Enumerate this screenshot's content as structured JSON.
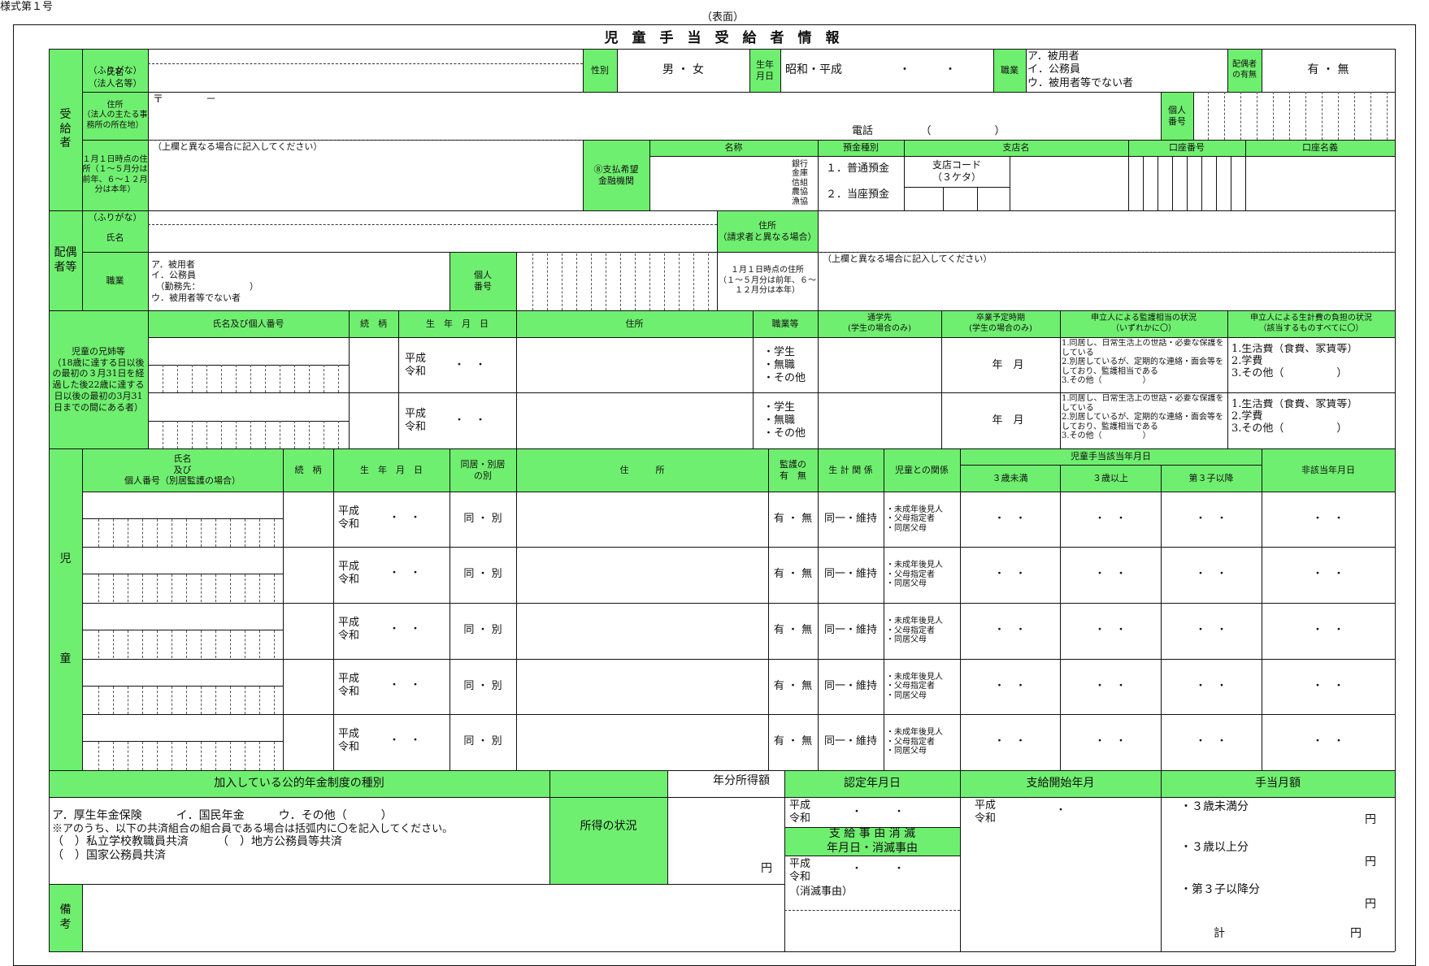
{
  "header": {
    "form_no": "様式第１号",
    "side": "（表面）",
    "title": "児　童　手　当　受　給　者　情　報"
  },
  "recipient": {
    "section": "受\n給\n者",
    "furigana": "（ふりがな）",
    "name": "氏名\n（法人名等）",
    "sex_label": "性別",
    "sex_value": "男 ・ 女",
    "birth_label": "生年\n月日",
    "birth_value": "昭和・平成　　　　　・　　　・",
    "job_label": "職業",
    "job_options": "ア．被用者\nイ．公務員\nウ．被用者等でない者",
    "spouse_label": "配偶者\nの有無",
    "spouse_value": "有 ・ 無",
    "address_label": "住所\n（法人の主たる事務所の所在地）",
    "postal": "〒　　　　－",
    "phone": "電話　　　　　（　　　　　　）",
    "mynumber_label": "個人\n番号",
    "jan_label": "１月１日時点の住所（１～５月分は前年、６～１２月分は本年）",
    "jan_note": "（上欄と異なる場合に記入してください）",
    "bank_label": "⑧支払希望\n金融機関",
    "bank_cols": [
      "名称",
      "預金種別",
      "支店名",
      "口座番号",
      "口座名義"
    ],
    "bank_types": "銀行\n金庫\n信組\n農協\n漁協",
    "deposit1": "１．普通預金",
    "deposit2": "２．当座預金",
    "branch_code": "支店コード\n（３ケタ）"
  },
  "spouse": {
    "section": "配偶\n者等",
    "furigana": "（ふりがな）",
    "name": "氏名",
    "address_label": "住所\n（請求者と異なる場合）",
    "job_label": "職業",
    "job_options": "ア．被用者\nイ．公務員\n　（勤務先：　　　　　　）\nウ．被用者等でない者",
    "mynumber_label": "個人\n番号",
    "jan_label": "１月１日時点の住所\n（１～５月分は前年、６～１２月分は本年）",
    "jan_note": "（上欄と異なる場合に記入してください）"
  },
  "siblings": {
    "section": "児童の兄姉等\n（18歳に達する日以後の最初の３月31日を経過した後22歳に達する日以後の最初の3月31日までの間にある者）",
    "cols": [
      "氏名及び個人番号",
      "続　柄",
      "生　年　月　日",
      "住所",
      "職業等",
      "通学先\n(学生の場合のみ)",
      "卒業予定時期\n(学生の場合のみ)",
      "申立人による監護相当の状況\n（いずれかに〇）",
      "申立人による生計費の負担の状況\n（該当するものすべてに〇）"
    ],
    "birth": "平成\n令和",
    "dots": "・　・",
    "job": "・学生\n・無職\n・その他",
    "grad": "年　月",
    "care": "1.同居し、日常生活上の世話・必要な保護をしている\n2.別居しているが、定期的な連絡・面会等をしており、監護相当である\n3.その他（　　　　　）",
    "cost": "1.生活費（食費、家賃等）\n2.学費\n3.その他（　　　　　）"
  },
  "children": {
    "section": "児\n\n\n\n\n\n\n童",
    "cols": [
      "氏名\n及び\n個人番号（別居監護の場合）",
      "続　柄",
      "生　年　月　日",
      "同居・別居\nの別",
      "住　　　所",
      "監護の\n有　無",
      "生 計 関 係",
      "児童との関係",
      "非該当年月日"
    ],
    "period_label": "児童手当該当年月日",
    "period_cols": [
      "３歳未満",
      "３歳以上",
      "第３子以降"
    ],
    "birth": "平成\n令和",
    "dots": "・　・",
    "live": "同 ・ 別",
    "care": "有 ・ 無",
    "livelihood": "同一・維持",
    "relation": "・未成年後見人\n・父母指定者\n・同居父母",
    "rows": 5
  },
  "bottom": {
    "pension_label": "加入している公的年金制度の種別",
    "pension_line1": "ア．厚生年金保険　　　イ．国民年金　　　ウ．その他（　　　）",
    "pension_line2": "※アのうち、以下の共済組合の組合員である場合は括弧内に〇を記入してください。",
    "pension_line3": "（　）私立学校教職員共済　　　（　）地方公務員等共済",
    "pension_line4": "（　）国家公務員共済",
    "income_label": "所得の状況",
    "income_amount": "年分所得額",
    "yen": "円",
    "approve_label": "認定年月日",
    "start_label": "支給開始年月",
    "monthly_label": "手当月額",
    "era": "平成\n令和",
    "dots": "・　　　・",
    "start_dot": "・",
    "stop_label": "支 給 事 由 消 滅\n年月日・消滅事由",
    "stop_reason": "（消滅事由）",
    "m1": "・３歳未満分",
    "m2": "・３歳以上分",
    "m3": "・第３子以降分",
    "total": "計",
    "remarks": "備\n考"
  }
}
